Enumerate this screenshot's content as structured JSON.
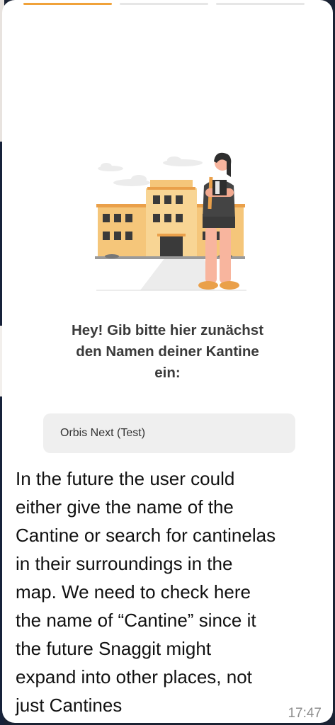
{
  "onboarding": {
    "question": "Hey! Gib bitte hier zunächst\nden Namen deiner Kantine\nein:",
    "input_value": "Orbis Next (Test)",
    "progress_total": 3,
    "progress_active": 1,
    "accent_color": "#f0a23a"
  },
  "message": {
    "text": "In the future the user could\neither give the name of the\nCantine or search for cantinelas\nin their surroundings in the\nmap. We need to check here\nthe name of “Cantine” since it\nthe future Snaggit might\nexpand into other places, not\njust Cantines",
    "time": "17:47"
  }
}
